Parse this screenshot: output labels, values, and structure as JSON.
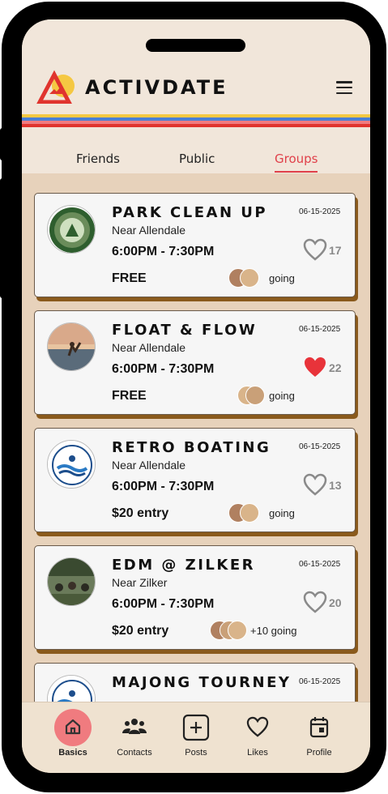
{
  "app": {
    "brand": "ACTIVDATE"
  },
  "colors": {
    "accent": "#e0404a",
    "stripes": [
      "#f1e6da",
      "#f5c842",
      "#4a7fd4",
      "#f07b7f",
      "#e0342e"
    ],
    "card_shadow": "#8a5a1c",
    "heart_liked": "#e8333a",
    "heart_outline": "#8a8a8a"
  },
  "tabs": [
    {
      "label": "Friends",
      "active": false
    },
    {
      "label": "Public",
      "active": false
    },
    {
      "label": "Groups",
      "active": true
    }
  ],
  "events": [
    {
      "title": "PARK CLEAN UP",
      "date": "06-15-2025",
      "location": "Near Allendale",
      "time": "6:00PM - 7:30PM",
      "price": "FREE",
      "likes": "17",
      "liked": false,
      "going": "going",
      "avatar": "park-protectors-logo"
    },
    {
      "title": "FLOAT & FLOW",
      "date": "06-15-2025",
      "location": "Near Allendale",
      "time": "6:00PM - 7:30PM",
      "price": "FREE",
      "likes": "22",
      "liked": true,
      "going": "going",
      "avatar": "yoga-photo"
    },
    {
      "title": "RETRO BOATING",
      "date": "06-15-2025",
      "location": "Near Allendale",
      "time": "6:00PM - 7:30PM",
      "price": "$20 entry",
      "likes": "13",
      "liked": false,
      "going": "going",
      "avatar": "aquarent-logo"
    },
    {
      "title": "EDM @ ZILKER",
      "date": "06-15-2025",
      "location": "Near Zilker",
      "time": "6:00PM - 7:30PM",
      "price": "$20 entry",
      "likes": "20",
      "liked": false,
      "going": "+10 going",
      "avatar": "festival-photo"
    },
    {
      "title": "MAJONG TOURNEY",
      "date": "06-15-2025",
      "avatar": "aquarent-logo"
    }
  ],
  "nav": [
    {
      "label": "Basics",
      "icon": "home-icon",
      "active": true
    },
    {
      "label": "Contacts",
      "icon": "contacts-icon",
      "active": false
    },
    {
      "label": "Posts",
      "icon": "add-post-icon",
      "active": false
    },
    {
      "label": "Likes",
      "icon": "heart-icon",
      "active": false
    },
    {
      "label": "Profile",
      "icon": "calendar-icon",
      "active": false
    }
  ]
}
